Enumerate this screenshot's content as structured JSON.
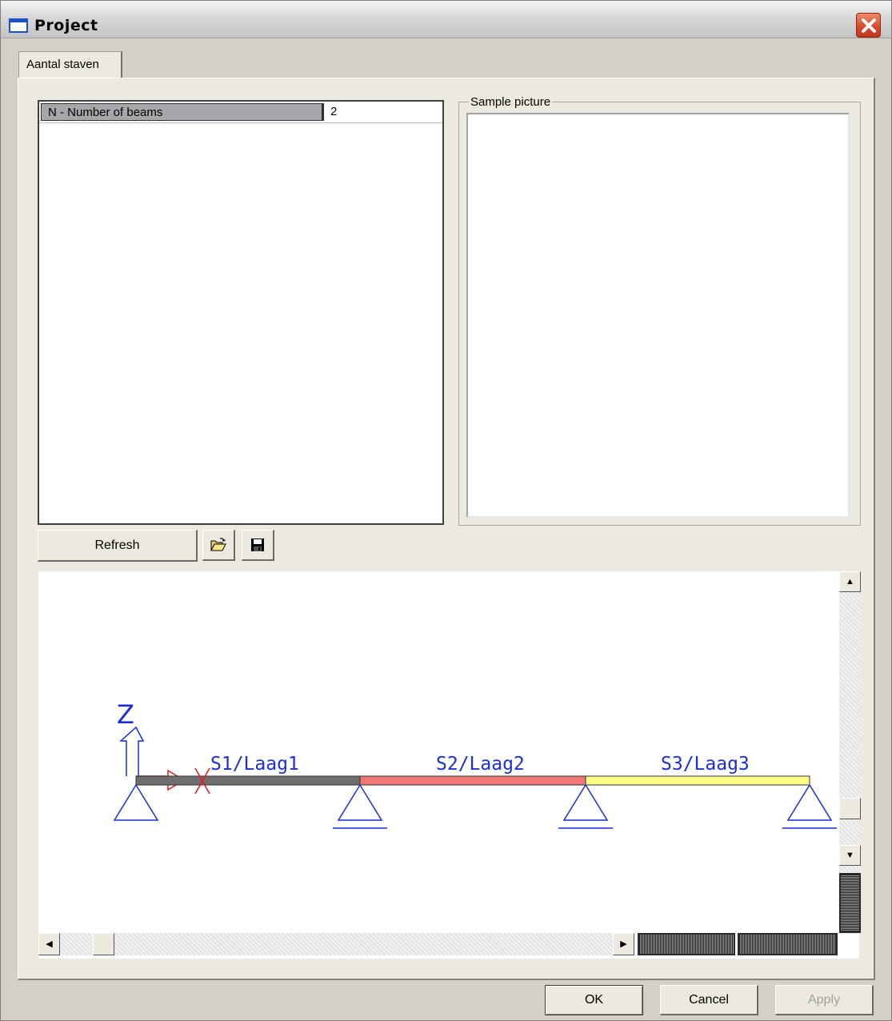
{
  "window": {
    "title": "Project"
  },
  "tabs": [
    {
      "label": "Aantal staven",
      "selected": true
    }
  ],
  "properties": [
    {
      "name": "N - Number of beams",
      "value": "2"
    }
  ],
  "sample_picture": {
    "label": "Sample picture"
  },
  "toolbar": {
    "refresh_label": "Refresh",
    "open_icon": "folder-open-icon",
    "save_icon": "floppy-disk-icon"
  },
  "diagram": {
    "axis_label": "Z",
    "beam_labels": [
      "S1/Laag1",
      "S2/Laag2",
      "S3/Laag3"
    ],
    "beam_colors": [
      "#6e6e6e",
      "#f07878",
      "#ffff88"
    ],
    "support_color": "#1a2fd8",
    "axis_color": "#1a2fd8",
    "origin_marker_color": "#e02020"
  },
  "dialog_buttons": {
    "ok": "OK",
    "cancel": "Cancel",
    "apply": "Apply",
    "apply_enabled": false
  }
}
